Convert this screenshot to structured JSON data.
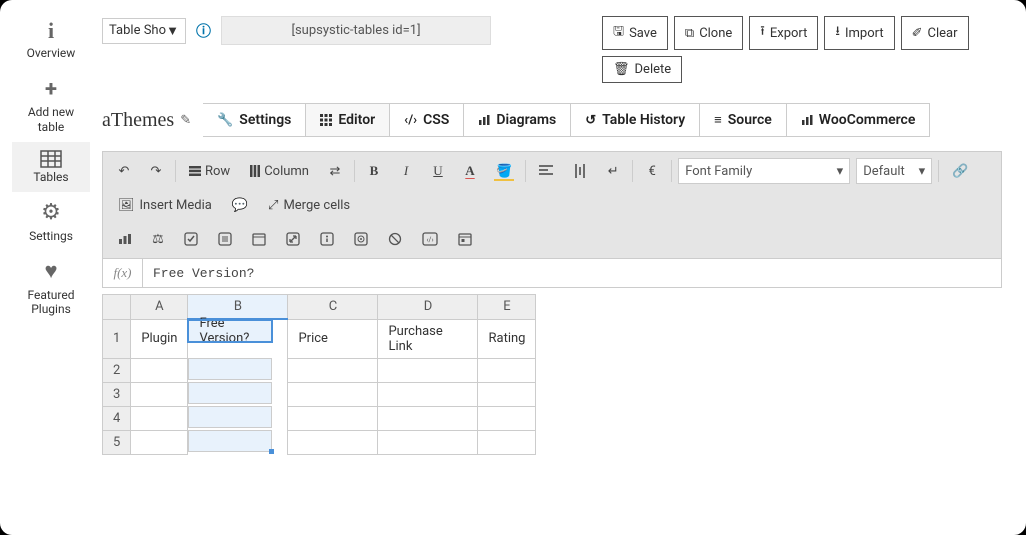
{
  "sidebar": {
    "items": [
      {
        "label": "Overview",
        "icon": "ℹ"
      },
      {
        "label": "Add new table",
        "icon": "+"
      },
      {
        "label": "Tables",
        "icon": "⊞"
      },
      {
        "label": "Settings",
        "icon": "⚙"
      },
      {
        "label": "Featured Plugins",
        "icon": "♥"
      }
    ]
  },
  "top": {
    "selector": "Table Shoı",
    "shortcode": "[supsystic-tables id=1]",
    "buttons": {
      "save": "Save",
      "clone": "Clone",
      "export": "Export",
      "import": "Import",
      "clear": "Clear",
      "delete": "Delete"
    }
  },
  "brand": "aThemes",
  "tabs": [
    {
      "label": "Settings",
      "icon": "wrench"
    },
    {
      "label": "Editor",
      "icon": "grid"
    },
    {
      "label": "CSS",
      "icon": "code"
    },
    {
      "label": "Diagrams",
      "icon": "bars"
    },
    {
      "label": "Table History",
      "icon": "history"
    },
    {
      "label": "Source",
      "icon": "stack"
    },
    {
      "label": "WooCommerce",
      "icon": "bars"
    }
  ],
  "toolbar": {
    "row_label": "Row",
    "col_label": "Column",
    "insert_media": "Insert Media",
    "merge_cells": "Merge cells",
    "font_family": "Font Family",
    "size_default": "Default"
  },
  "formula": {
    "label": "f(x)",
    "value": "Free Version?"
  },
  "sheet": {
    "columns": [
      "A",
      "B",
      "C",
      "D",
      "E"
    ],
    "rows": [
      {
        "n": "1",
        "cells": [
          "Plugin",
          "Free Version?",
          "Price",
          "Purchase Link",
          "Rating"
        ]
      },
      {
        "n": "2",
        "cells": [
          "",
          "",
          "",
          "",
          ""
        ]
      },
      {
        "n": "3",
        "cells": [
          "",
          "",
          "",
          "",
          ""
        ]
      },
      {
        "n": "4",
        "cells": [
          "",
          "",
          "",
          "",
          ""
        ]
      },
      {
        "n": "5",
        "cells": [
          "",
          "",
          "",
          "",
          ""
        ]
      }
    ],
    "active_col": 1,
    "active_row": 0
  }
}
